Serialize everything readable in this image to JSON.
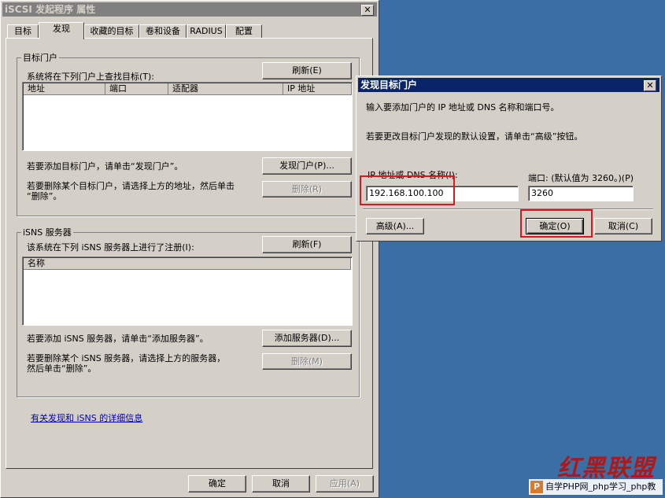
{
  "main_dialog": {
    "title": "iSCSI 发起程序 属性",
    "close_label": "✕",
    "tabs": [
      "目标",
      "发现",
      "收藏的目标",
      "卷和设备",
      "RADIUS",
      "配置"
    ],
    "portal_group": {
      "label": "目标门户",
      "description": "系统将在下列门户上查找目标(T):",
      "refresh_button": "刷新(E)",
      "columns": [
        "地址",
        "端口",
        "适配器",
        "IP 地址"
      ],
      "add_hint": "若要添加目标门户，请单击“发现门户”。",
      "discover_button": "发现门户(P)...",
      "remove_hint_line1": "若要删除某个目标门户，请选择上方的地址，然后单击",
      "remove_hint_line2": "“删除”。",
      "remove_button": "删除(R)"
    },
    "isns_group": {
      "label": "iSNS 服务器",
      "description": "该系统在下列 iSNS 服务器上进行了注册(I):",
      "refresh_button": "刷新(F)",
      "columns": [
        "名称"
      ],
      "add_hint": "若要添加 iSNS 服务器，请单击“添加服务器”。",
      "add_button": "添加服务器(D)...",
      "remove_hint_line1": "若要删除某个 iSNS 服务器，请选择上方的服务器，",
      "remove_hint_line2": "然后单击“删除”。",
      "remove_button": "删除(M)"
    },
    "info_link": "有关发现和 iSNS 的详细信息",
    "ok_button": "确定",
    "cancel_button": "取消",
    "apply_button": "应用(A)"
  },
  "discover_dialog": {
    "title": "发现目标门户",
    "close_label": "✕",
    "intro": "输入要添加门户的 IP 地址或 DNS 名称和端口号。",
    "advanced_hint": "若要更改目标门户发现的默认设置，请单击“高级”按钮。",
    "ip_label": "IP 地址或 DNS 名称(I):",
    "ip_value": "192.168.100.100",
    "port_label": "端口: (默认值为 3260。)(P)",
    "port_value": "3260",
    "advanced_button": "高级(A)...",
    "ok_button": "确定(O)",
    "cancel_button": "取消(C)"
  },
  "watermark": {
    "brand": "红黑联盟",
    "site_badge": "P",
    "site_text": "自学PHP网_php学习_php教"
  },
  "colors": {
    "desktop": "#3a6ea5",
    "highlight_box": "#e0141e",
    "active_title": "#0a246a"
  }
}
